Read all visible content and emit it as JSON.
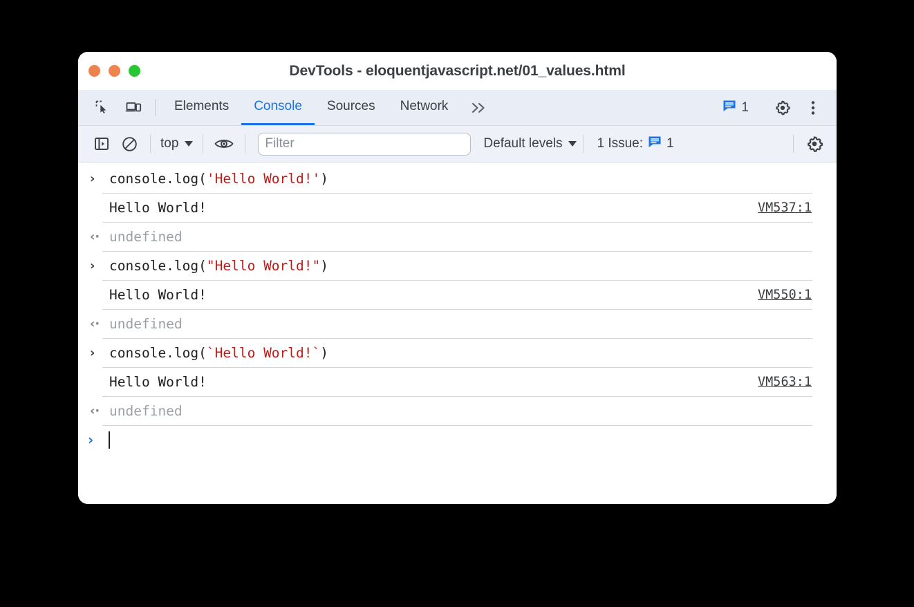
{
  "window": {
    "title": "DevTools - eloquentjavascript.net/01_values.html",
    "traffic_lights": [
      "close",
      "minimize",
      "zoom"
    ]
  },
  "tabbar": {
    "inspect_icon": "inspect-cursor-icon",
    "device_icon": "device-toolbar-icon",
    "tabs": [
      {
        "label": "Elements",
        "active": false
      },
      {
        "label": "Console",
        "active": true
      },
      {
        "label": "Sources",
        "active": false
      },
      {
        "label": "Network",
        "active": false
      }
    ],
    "overflow_label": "»",
    "issue_count": "1",
    "settings_icon": "gear-icon",
    "more_icon": "kebab-menu-icon"
  },
  "console_toolbar": {
    "sidebar_icon": "sidebar-toggle-icon",
    "clear_icon": "clear-console-icon",
    "context": "top",
    "eye_icon": "live-expression-eye-icon",
    "filter_placeholder": "Filter",
    "filter_value": "",
    "levels_label": "Default levels",
    "issues_label": "1 Issue:",
    "issues_badge_count": "1",
    "settings_icon": "console-settings-gear-icon"
  },
  "console_rows": [
    {
      "kind": "input",
      "marker": "›",
      "prefix": "console.log(",
      "string": "'Hello World!'",
      "suffix": ")",
      "source": ""
    },
    {
      "kind": "log",
      "marker": "",
      "text": "Hello World!",
      "source": "VM537:1"
    },
    {
      "kind": "result",
      "marker": "‹·",
      "text": "undefined",
      "source": ""
    },
    {
      "kind": "input",
      "marker": "›",
      "prefix": "console.log(",
      "string": "\"Hello World!\"",
      "suffix": ")",
      "source": ""
    },
    {
      "kind": "log",
      "marker": "",
      "text": "Hello World!",
      "source": "VM550:1"
    },
    {
      "kind": "result",
      "marker": "‹·",
      "text": "undefined",
      "source": ""
    },
    {
      "kind": "input",
      "marker": "›",
      "prefix": "console.log(",
      "string": "`Hello World!`",
      "suffix": ")",
      "source": ""
    },
    {
      "kind": "log",
      "marker": "",
      "text": "Hello World!",
      "source": "VM563:1"
    },
    {
      "kind": "result",
      "marker": "‹·",
      "text": "undefined",
      "source": ""
    },
    {
      "kind": "prompt",
      "marker": "›",
      "text": "",
      "source": ""
    }
  ],
  "colors": {
    "accent_blue": "#1a73e8",
    "string_red": "#c41a16",
    "undefined_gray": "#9aa0a6",
    "toolbar_bg": "#eef1f8",
    "tabbar_bg": "#e9edf6",
    "separator": "#c9d7ee",
    "traffic_orange": "#ee8350",
    "traffic_green": "#28c732"
  }
}
